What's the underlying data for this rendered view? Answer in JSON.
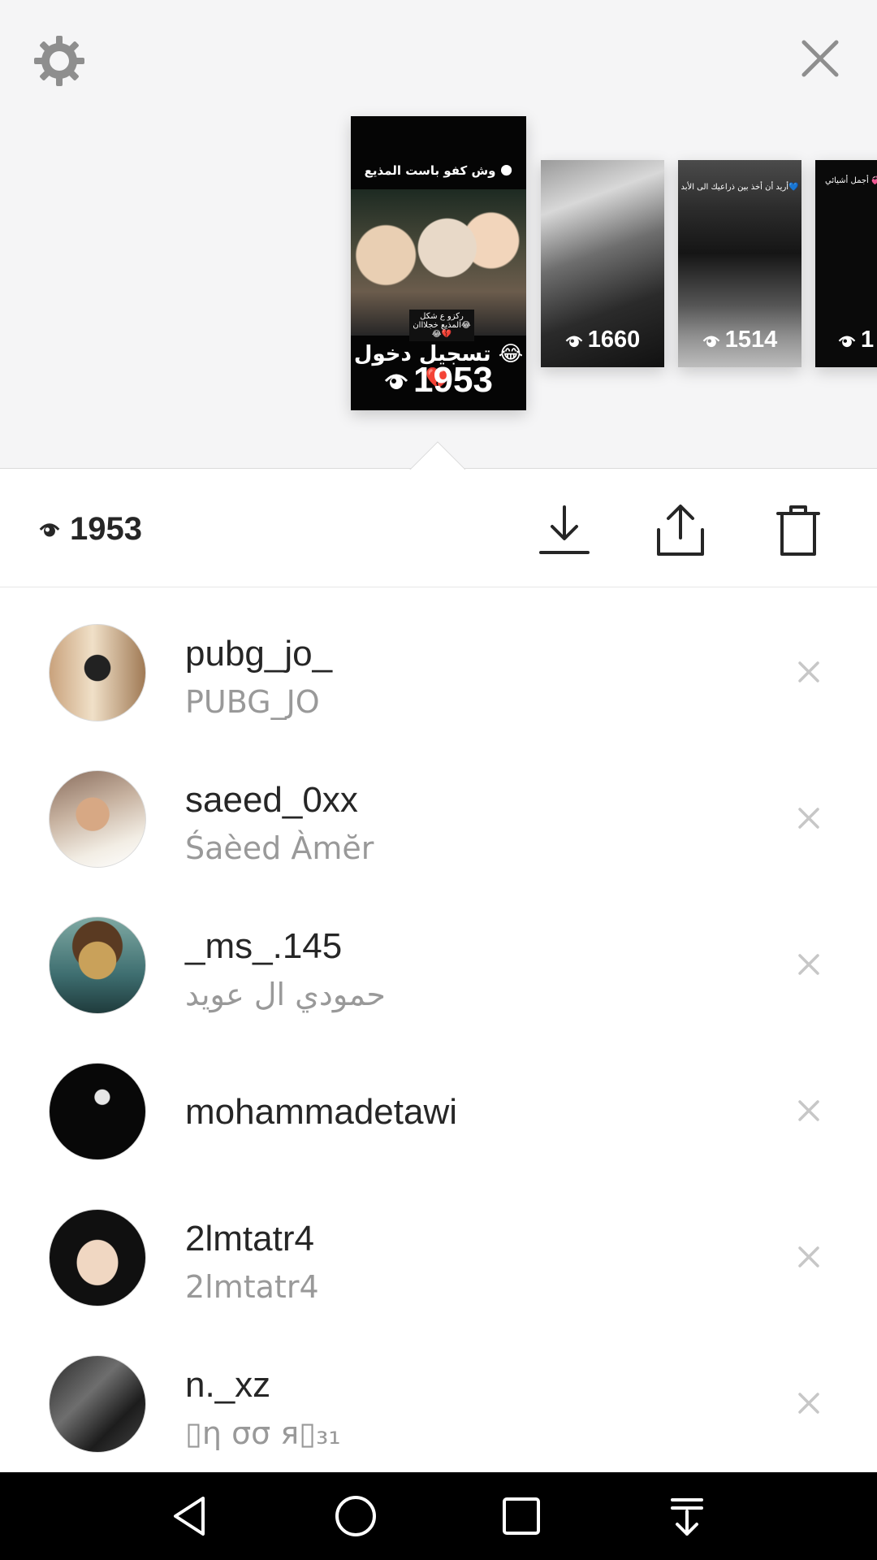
{
  "tray": {
    "stories": [
      {
        "views": "1953",
        "caption_top": "وش كفو باست المذيع 🌑",
        "caption_mid": "ركزو ع شكل المذيع خجلااان😂😂💔",
        "caption_bottom": "تسجيل دخول 😂💔"
      },
      {
        "views": "1660"
      },
      {
        "views": "1514",
        "caption_top": "أريد أن أخذ بين ذراعيك الى الأبد💙"
      },
      {
        "views": "1",
        "caption_top": "أجمل أشيائي 💞"
      }
    ]
  },
  "action_bar": {
    "view_count": "1953"
  },
  "viewers": [
    {
      "username": "pubg_jo_",
      "fullname": "PUBG_JO"
    },
    {
      "username": "saeed_0xx",
      "fullname": "Śaèed Àmĕr"
    },
    {
      "username": "_ms_.145",
      "fullname": "حمودي ال عويد"
    },
    {
      "username": "mohammadetawi",
      "fullname": ""
    },
    {
      "username": "2lmtatr4",
      "fullname": "2lmtatr4"
    },
    {
      "username": "n._xz",
      "fullname": "▯η σσ я▯₃₁"
    }
  ],
  "icons": {
    "settings": "gear-icon",
    "close": "close-icon",
    "views": "eye-icon",
    "download": "download-icon",
    "share": "share-icon",
    "delete": "trash-icon",
    "dismiss": "dismiss-icon"
  },
  "colors": {
    "tray_bg": "#f5f5f6",
    "text_primary": "#262626",
    "text_secondary": "#999999",
    "icon_gray": "#8e8e8e",
    "nav_bg": "#000000"
  }
}
